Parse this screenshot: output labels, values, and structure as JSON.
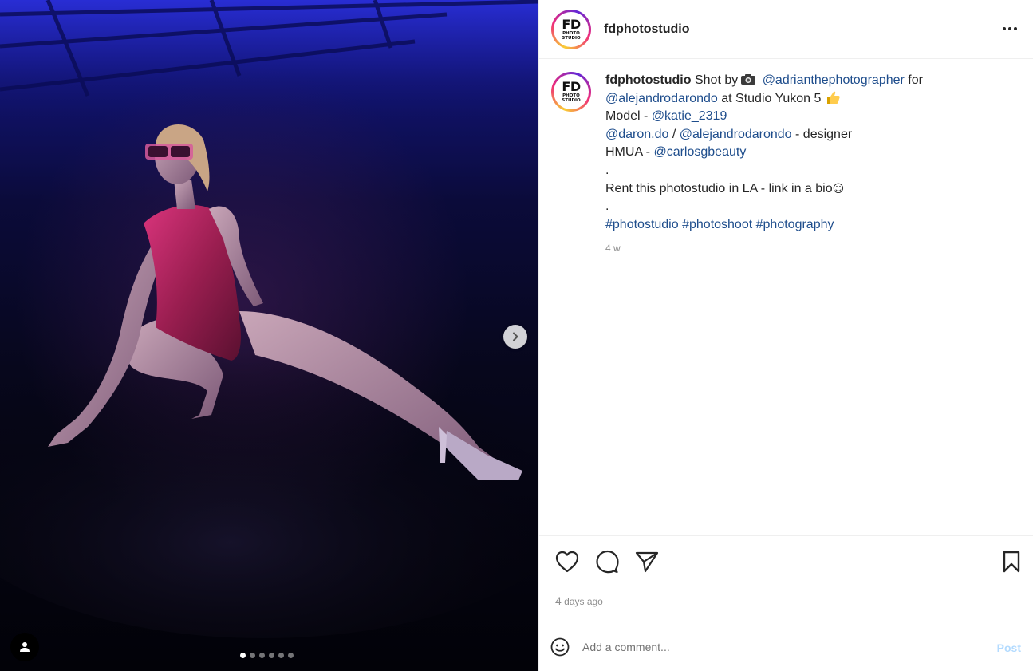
{
  "account": {
    "username": "fdphotostudio",
    "logo_main": "FD",
    "logo_line1": "PHOTO",
    "logo_line2": "STUDIO"
  },
  "caption": {
    "username": "fdphotostudio",
    "shot_by": "Shot by",
    "mention_photographer": "@adrianthephotographer",
    "for_word": "for",
    "mention_designer": "@alejandrodarondo",
    "studio_text": "at Studio Yukon 5",
    "model_label": "Model -",
    "mention_model": "@katie_2319",
    "mention_daron": "@daron.do",
    "slash": "/",
    "mention_designer2": "@alejandrodarondo",
    "designer_suffix": "- designer",
    "hmua_label": "HMUA -",
    "mention_hmua": "@carlosgbeauty",
    "dot1": ".",
    "rent_text": "Rent this photostudio in LA - link in a bio",
    "smile": "☺",
    "dot2": ".",
    "hashtag1": "#photostudio",
    "hashtag2": "#photoshoot",
    "hashtag3": "#photography",
    "time_ago": "4 w"
  },
  "posted": {
    "number": "4",
    "unit": "days ago"
  },
  "comment": {
    "placeholder": "Add a comment...",
    "post_label": "Post"
  },
  "carousel": {
    "slide_count": 6,
    "active_index": 0
  },
  "icons": {
    "more": "more-options-icon",
    "next": "chevron-right-icon",
    "user_tag": "user-icon",
    "like": "heart-icon",
    "comment": "comment-icon",
    "share": "send-icon",
    "save": "bookmark-icon",
    "emoji": "emoji-icon"
  },
  "colors": {
    "link": "#1e4d8c",
    "muted": "#8e8e8e",
    "post_disabled": "#b3dbff",
    "dress": "#b0245e"
  }
}
